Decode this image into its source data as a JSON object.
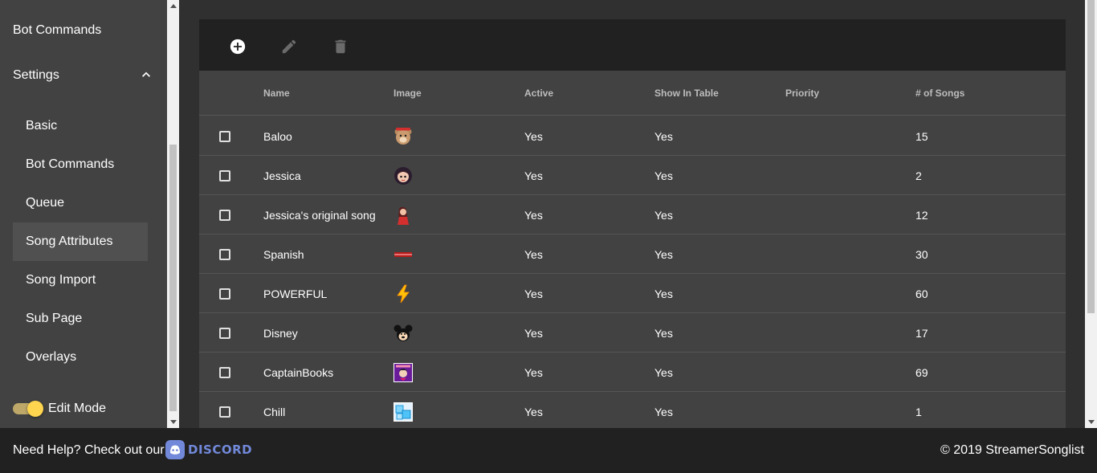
{
  "sidebar": {
    "top_item": "Bot Commands",
    "settings_label": "Settings",
    "sub_items": [
      {
        "label": "Basic"
      },
      {
        "label": "Bot Commands"
      },
      {
        "label": "Queue"
      },
      {
        "label": "Song Attributes",
        "active": true
      },
      {
        "label": "Song Import"
      },
      {
        "label": "Sub Page"
      },
      {
        "label": "Overlays"
      }
    ],
    "edit_mode_label": "Edit Mode",
    "edit_mode_on": true
  },
  "toolbar": {
    "add_icon": "add-circle-icon",
    "edit_icon": "pencil-icon",
    "delete_icon": "trash-icon"
  },
  "table": {
    "headers": [
      "Name",
      "Image",
      "Active",
      "Show In Table",
      "Priority",
      "# of Songs"
    ],
    "rows": [
      {
        "name": "Baloo",
        "image": "bear-emote",
        "active": "Yes",
        "show": "Yes",
        "priority": "",
        "songs": "15"
      },
      {
        "name": "Jessica",
        "image": "jessica-emote",
        "active": "Yes",
        "show": "Yes",
        "priority": "",
        "songs": "2"
      },
      {
        "name": "Jessica's original song",
        "image": "red-dress-emote",
        "active": "Yes",
        "show": "Yes",
        "priority": "",
        "songs": "12"
      },
      {
        "name": "Spanish",
        "image": "red-banner-emote",
        "active": "Yes",
        "show": "Yes",
        "priority": "",
        "songs": "30"
      },
      {
        "name": "POWERFUL",
        "image": "lightning-emote",
        "active": "Yes",
        "show": "Yes",
        "priority": "",
        "songs": "60"
      },
      {
        "name": "Disney",
        "image": "mickey-emote",
        "active": "Yes",
        "show": "Yes",
        "priority": "",
        "songs": "17"
      },
      {
        "name": "CaptainBooks",
        "image": "captain-emote",
        "active": "Yes",
        "show": "Yes",
        "priority": "",
        "songs": "69"
      },
      {
        "name": "Chill",
        "image": "ice-emote",
        "active": "Yes",
        "show": "Yes",
        "priority": "",
        "songs": "1"
      }
    ]
  },
  "footer": {
    "help_text": "Need Help? Check out our",
    "discord_label": "DISCORD",
    "copyright": "© 2019 StreamerSonglist"
  },
  "colors": {
    "accent": "#ffd54f",
    "discord": "#7289da",
    "toolbar_bg": "#212121",
    "panel_bg": "#424242"
  }
}
